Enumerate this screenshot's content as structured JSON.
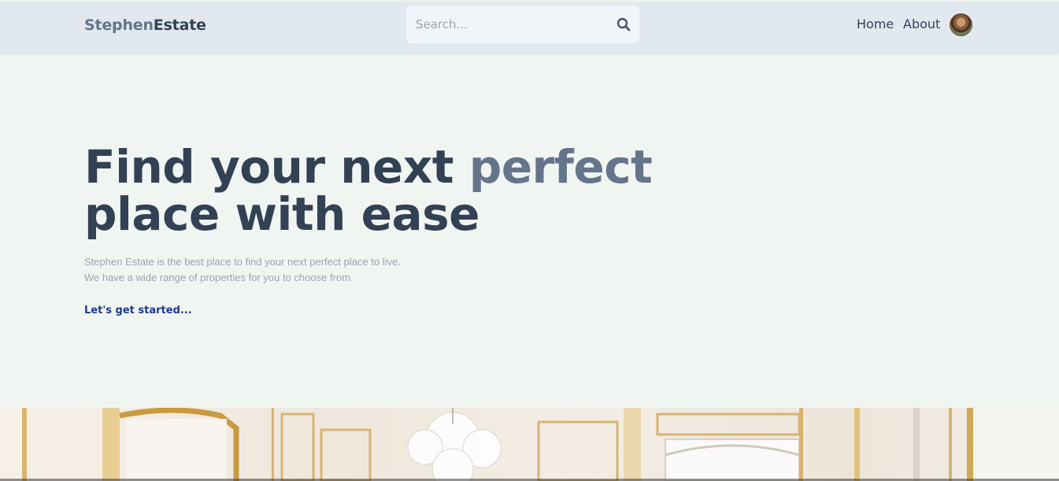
{
  "header": {
    "logo_part1": "Stephen",
    "logo_part2": "Estate",
    "search_placeholder": "Search...",
    "nav": {
      "home": "Home",
      "about": "About"
    }
  },
  "hero": {
    "title_part1": "Find your next ",
    "title_accent": "perfect",
    "title_part2": "place with ease",
    "description_line1": "Stephen Estate is the best place to find your next perfect place to live.",
    "description_line2": "We have a wide range of properties for you to choose from.",
    "cta_label": "Let's get started..."
  },
  "colors": {
    "header_bg": "#e2e8f0",
    "page_bg": "#f1f5f1",
    "title_dark": "#334155",
    "title_accent": "#64748b",
    "cta": "#1e3a8a"
  },
  "icons": {
    "search": "search-icon",
    "avatar": "user-avatar"
  }
}
